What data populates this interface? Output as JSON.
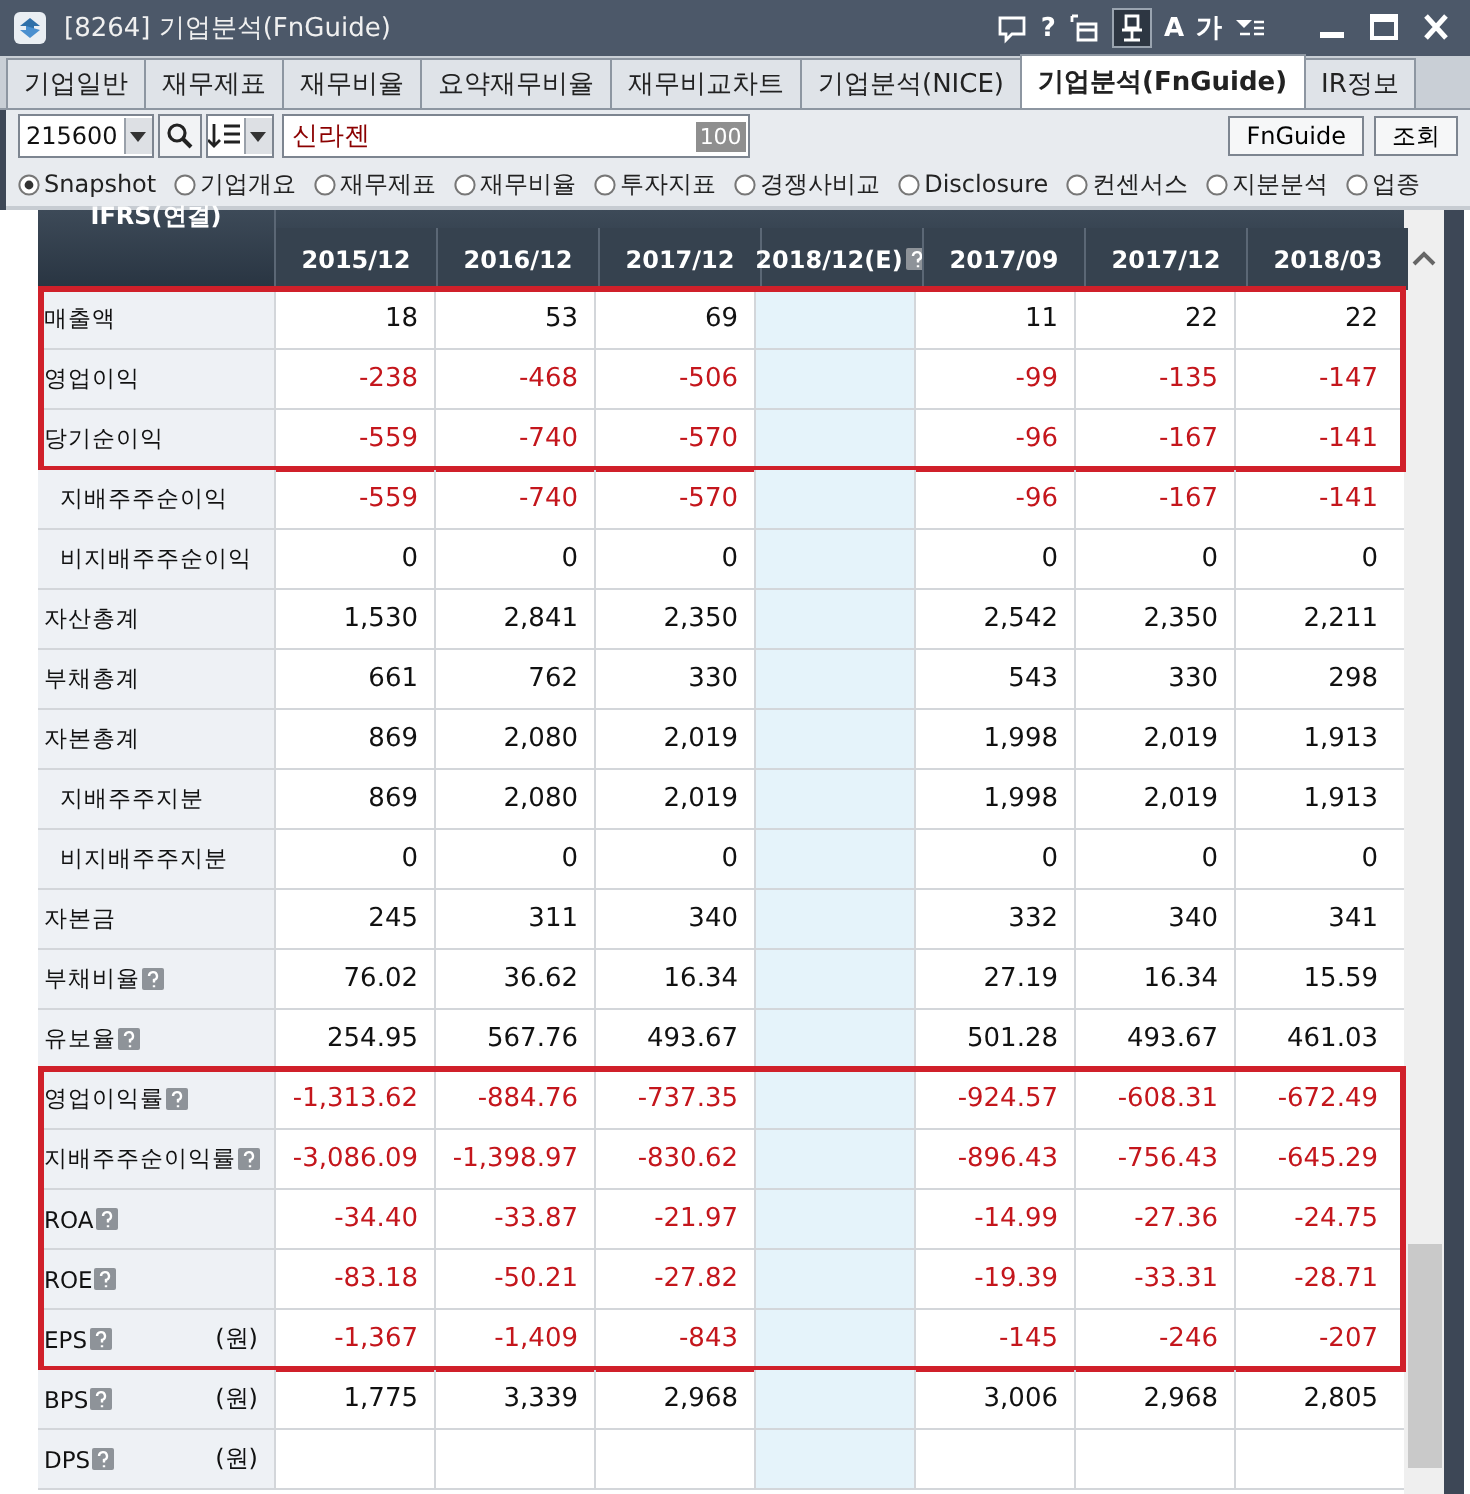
{
  "window": {
    "title": "[8264] 기업분석(FnGuide)",
    "tools": [
      {
        "kind": "chat"
      },
      {
        "kind": "char",
        "text": "?"
      },
      {
        "kind": "window"
      },
      {
        "kind": "pin",
        "selected": true
      },
      {
        "kind": "char",
        "text": "A"
      },
      {
        "kind": "char",
        "text": "가"
      },
      {
        "kind": "menu"
      }
    ]
  },
  "tabs": [
    {
      "label": "기업일반",
      "selected": false
    },
    {
      "label": "재무제표",
      "selected": false
    },
    {
      "label": "재무비율",
      "selected": false
    },
    {
      "label": "요약재무비율",
      "selected": false
    },
    {
      "label": "재무비교차트",
      "selected": false
    },
    {
      "label": "기업분석(NICE)",
      "selected": false
    },
    {
      "label": "기업분석(FnGuide)",
      "selected": true
    },
    {
      "label": "IR정보",
      "selected": false
    }
  ],
  "toolbar": {
    "code": "215600",
    "company": "신라젠",
    "badge": "100",
    "buttons": [
      "FnGuide",
      "조회"
    ]
  },
  "sections": [
    {
      "label": "Snapshot",
      "selected": true
    },
    {
      "label": "기업개요",
      "selected": false
    },
    {
      "label": "재무제표",
      "selected": false
    },
    {
      "label": "재무비율",
      "selected": false
    },
    {
      "label": "투자지표",
      "selected": false
    },
    {
      "label": "경쟁사비교",
      "selected": false
    },
    {
      "label": "Disclosure",
      "selected": false
    },
    {
      "label": "컨센서스",
      "selected": false
    },
    {
      "label": "지분분석",
      "selected": false
    },
    {
      "label": "업종",
      "selected": false
    }
  ],
  "table": {
    "corner": "IFRS(연결)",
    "columns": [
      {
        "label": "2015/12",
        "estimate": false
      },
      {
        "label": "2016/12",
        "estimate": false
      },
      {
        "label": "2017/12",
        "estimate": false
      },
      {
        "label": "2018/12(E)",
        "estimate": true
      },
      {
        "label": "2017/09",
        "estimate": false
      },
      {
        "label": "2017/12",
        "estimate": false
      },
      {
        "label": "2018/03",
        "estimate": false
      }
    ],
    "rows": [
      {
        "label": "매출액",
        "help": false,
        "negative": false,
        "highlighted": true,
        "annual": [
          "18",
          "53",
          "69"
        ],
        "quarterly": [
          "11",
          "22",
          "22"
        ]
      },
      {
        "label": "영업이익",
        "help": false,
        "negative": true,
        "highlighted": true,
        "annual": [
          "-238",
          "-468",
          "-506"
        ],
        "quarterly": [
          "-99",
          "-135",
          "-147"
        ]
      },
      {
        "label": "당기순이익",
        "help": false,
        "negative": true,
        "highlighted": true,
        "annual": [
          "-559",
          "-740",
          "-570"
        ],
        "quarterly": [
          "-96",
          "-167",
          "-141"
        ],
        "children": [
          {
            "label": "지배주주순이익",
            "help": false,
            "negative": true,
            "highlighted": false,
            "annual": [
              "-559",
              "-740",
              "-570"
            ],
            "quarterly": [
              "-96",
              "-167",
              "-141"
            ]
          },
          {
            "label": "비지배주주순이익",
            "help": false,
            "negative": false,
            "highlighted": false,
            "annual": [
              "0",
              "0",
              "0"
            ],
            "quarterly": [
              "0",
              "0",
              "0"
            ]
          }
        ]
      },
      {
        "label": "자산총계",
        "help": false,
        "negative": false,
        "highlighted": false,
        "annual": [
          "1,530",
          "2,841",
          "2,350"
        ],
        "quarterly": [
          "2,542",
          "2,350",
          "2,211"
        ]
      },
      {
        "label": "부채총계",
        "help": false,
        "negative": false,
        "highlighted": false,
        "annual": [
          "661",
          "762",
          "330"
        ],
        "quarterly": [
          "543",
          "330",
          "298"
        ]
      },
      {
        "label": "자본총계",
        "help": false,
        "negative": false,
        "highlighted": false,
        "annual": [
          "869",
          "2,080",
          "2,019"
        ],
        "quarterly": [
          "1,998",
          "2,019",
          "1,913"
        ],
        "children": [
          {
            "label": "지배주주지분",
            "help": false,
            "negative": false,
            "highlighted": false,
            "annual": [
              "869",
              "2,080",
              "2,019"
            ],
            "quarterly": [
              "1,998",
              "2,019",
              "1,913"
            ]
          },
          {
            "label": "비지배주주지분",
            "help": false,
            "negative": false,
            "highlighted": false,
            "annual": [
              "0",
              "0",
              "0"
            ],
            "quarterly": [
              "0",
              "0",
              "0"
            ]
          }
        ]
      },
      {
        "label": "자본금",
        "help": false,
        "negative": false,
        "highlighted": false,
        "annual": [
          "245",
          "311",
          "340"
        ],
        "quarterly": [
          "332",
          "340",
          "341"
        ]
      },
      {
        "label": "부채비율",
        "help": true,
        "negative": false,
        "highlighted": false,
        "annual": [
          "76.02",
          "36.62",
          "16.34"
        ],
        "quarterly": [
          "27.19",
          "16.34",
          "15.59"
        ]
      },
      {
        "label": "유보율",
        "help": true,
        "negative": false,
        "highlighted": false,
        "annual": [
          "254.95",
          "567.76",
          "493.67"
        ],
        "quarterly": [
          "501.28",
          "493.67",
          "461.03"
        ]
      },
      {
        "label": "영업이익률",
        "help": true,
        "negative": true,
        "highlighted": true,
        "annual": [
          "-1,313.62",
          "-884.76",
          "-737.35"
        ],
        "quarterly": [
          "-924.57",
          "-608.31",
          "-672.49"
        ]
      },
      {
        "label": "지배주주순이익률",
        "help": true,
        "negative": true,
        "highlighted": true,
        "annual": [
          "-3,086.09",
          "-1,398.97",
          "-830.62"
        ],
        "quarterly": [
          "-896.43",
          "-756.43",
          "-645.29"
        ]
      },
      {
        "label": "ROA",
        "help": true,
        "negative": true,
        "highlighted": true,
        "annual": [
          "-34.40",
          "-33.87",
          "-21.97"
        ],
        "quarterly": [
          "-14.99",
          "-27.36",
          "-24.75"
        ]
      },
      {
        "label": "ROE",
        "help": true,
        "negative": true,
        "highlighted": true,
        "annual": [
          "-83.18",
          "-50.21",
          "-27.82"
        ],
        "quarterly": [
          "-19.39",
          "-33.31",
          "-28.71"
        ]
      },
      {
        "label": "EPS",
        "unit": "(원)",
        "help": true,
        "negative": true,
        "highlighted": true,
        "annual": [
          "-1,367",
          "-1,409",
          "-843"
        ],
        "quarterly": [
          "-145",
          "-246",
          "-207"
        ]
      },
      {
        "label": "BPS",
        "unit": "(원)",
        "help": true,
        "negative": false,
        "highlighted": false,
        "annual": [
          "1,775",
          "3,339",
          "2,968"
        ],
        "quarterly": [
          "3,006",
          "2,968",
          "2,805"
        ]
      },
      {
        "label": "DPS",
        "unit": "(원)",
        "help": true,
        "negative": false,
        "highlighted": false
      }
    ]
  }
}
